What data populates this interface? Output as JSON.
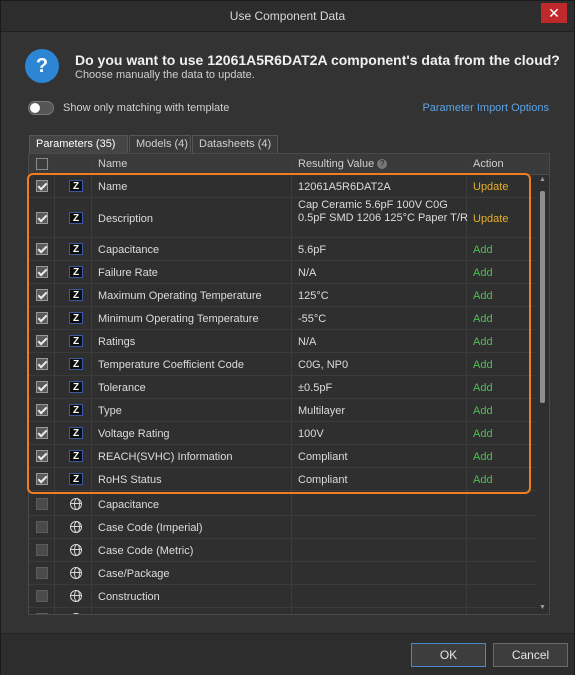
{
  "window": {
    "title": "Use Component Data",
    "close_label": "✕"
  },
  "header": {
    "icon": "question-icon",
    "question": "Do you want to use 12061A5R6DAT2A component's data from the cloud?",
    "subtitle": "Choose manually the data to update."
  },
  "toggle": {
    "label": "Show only matching with template",
    "on": false
  },
  "param_link": "Parameter Import Options",
  "tabs": [
    {
      "label": "Parameters (35)",
      "active": true
    },
    {
      "label": "Models (4)",
      "active": false
    },
    {
      "label": "Datasheets (4)",
      "active": false
    }
  ],
  "columns": {
    "name": "Name",
    "value": "Resulting Value",
    "action": "Action"
  },
  "colors": {
    "highlight": "#f07d1e",
    "update": "#e6b12a",
    "add": "#4fbf55",
    "link": "#5aa3e6"
  },
  "rows": [
    {
      "name": "Name",
      "value": "12061A5R6DAT2A",
      "action": "Update"
    },
    {
      "name": "Description",
      "value": "Cap Ceramic 5.6pF 100V C0G 0.5pF SMD 1206 125°C Paper T/R",
      "action": "Update"
    },
    {
      "name": "Capacitance",
      "value": "5.6pF",
      "action": "Add"
    },
    {
      "name": "Failure Rate",
      "value": "N/A",
      "action": "Add"
    },
    {
      "name": "Maximum Operating Temperature",
      "value": "125°C",
      "action": "Add"
    },
    {
      "name": "Minimum Operating Temperature",
      "value": "-55°C",
      "action": "Add"
    },
    {
      "name": "Ratings",
      "value": "N/A",
      "action": "Add"
    },
    {
      "name": "Temperature Coefficient Code",
      "value": "C0G, NP0",
      "action": "Add"
    },
    {
      "name": "Tolerance",
      "value": "±0.5pF",
      "action": "Add"
    },
    {
      "name": "Type",
      "value": "Multilayer",
      "action": "Add"
    },
    {
      "name": "Voltage Rating",
      "value": "100V",
      "action": "Add"
    },
    {
      "name": "REACH(SVHC) Information",
      "value": "Compliant",
      "action": "Add"
    },
    {
      "name": "RoHS Status",
      "value": "Compliant",
      "action": "Add"
    }
  ],
  "other_rows": [
    {
      "name": "Capacitance"
    },
    {
      "name": "Case Code (Imperial)"
    },
    {
      "name": "Case Code (Metric)"
    },
    {
      "name": "Case/Package"
    },
    {
      "name": "Construction"
    }
  ],
  "buttons": {
    "ok": "OK",
    "cancel": "Cancel"
  }
}
